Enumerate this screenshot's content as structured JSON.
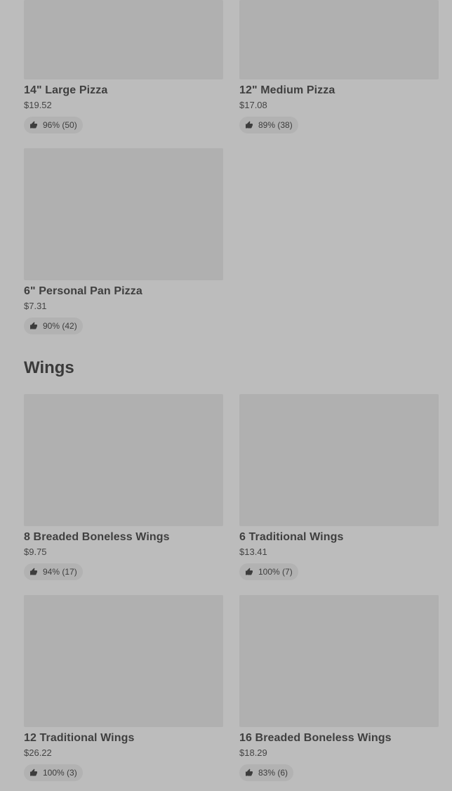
{
  "pizza_items": [
    {
      "name": "14\" Large Pizza",
      "price": "$19.52",
      "rating": "96% (50)"
    },
    {
      "name": "12\" Medium Pizza",
      "price": "$17.08",
      "rating": "89% (38)"
    },
    {
      "name": "6\" Personal Pan Pizza",
      "price": "$7.31",
      "rating": "90% (42)"
    }
  ],
  "wings": {
    "title": "Wings",
    "items": [
      {
        "name": "8 Breaded Boneless Wings",
        "price": "$9.75",
        "rating": "94% (17)"
      },
      {
        "name": "6 Traditional Wings",
        "price": "$13.41",
        "rating": "100% (7)"
      },
      {
        "name": "12 Traditional Wings",
        "price": "$26.22",
        "rating": "100% (3)"
      },
      {
        "name": "16 Breaded Boneless Wings",
        "price": "$18.29",
        "rating": "83% (6)"
      }
    ]
  },
  "icons": {
    "rating": "thumbs-up-icon"
  }
}
